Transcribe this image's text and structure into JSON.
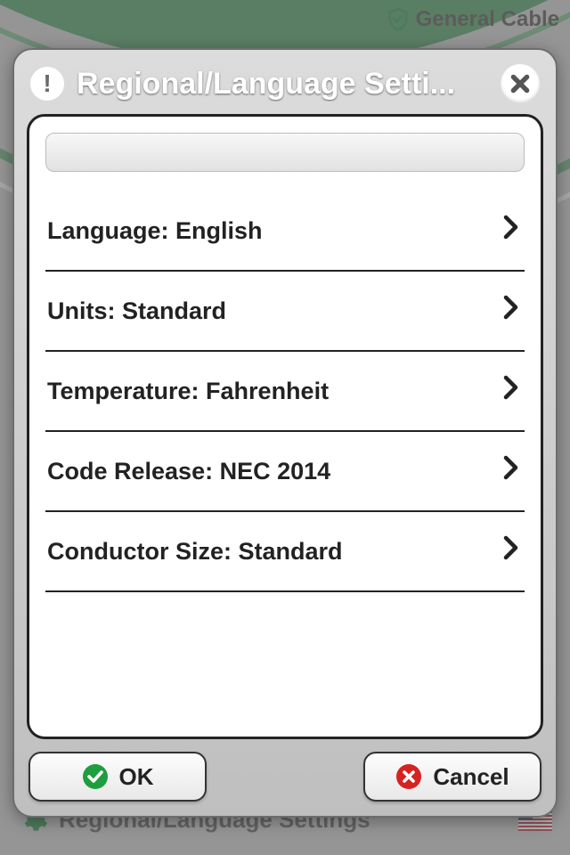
{
  "brand": {
    "name": "General Cable"
  },
  "dialog": {
    "title": "Regional/Language Setti...",
    "rows": [
      {
        "label": "Language: English"
      },
      {
        "label": "Units: Standard"
      },
      {
        "label": "Temperature: Fahrenheit"
      },
      {
        "label": "Code Release: NEC 2014"
      },
      {
        "label": "Conductor Size: Standard"
      }
    ],
    "ok_label": "OK",
    "cancel_label": "Cancel"
  },
  "bottom_bar": {
    "label": "Regional/Language Settings"
  }
}
